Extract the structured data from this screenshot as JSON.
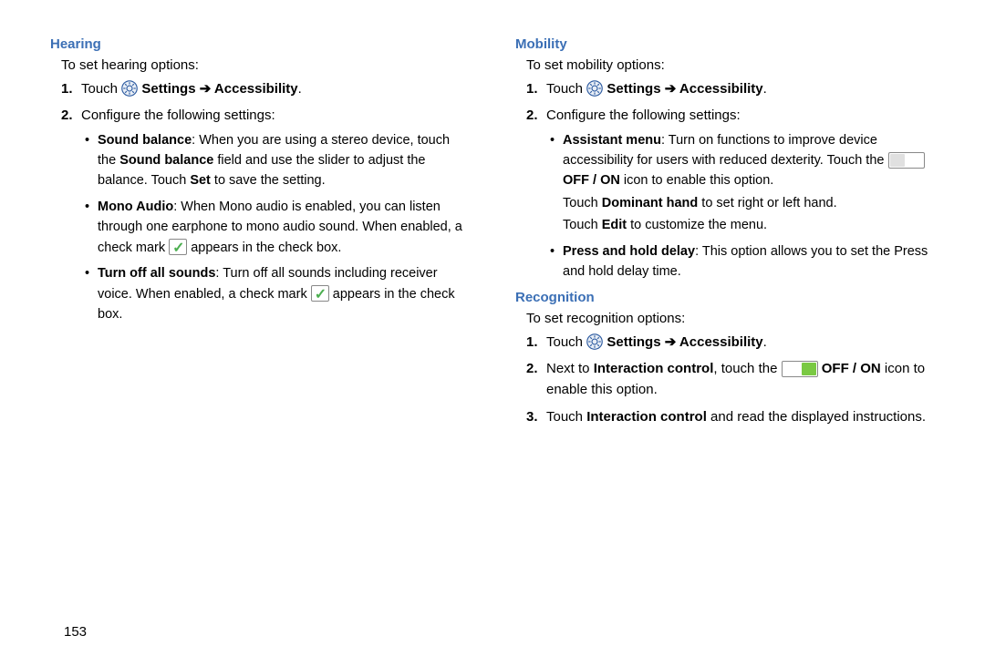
{
  "page_number": "153",
  "left": {
    "header": "Hearing",
    "intro": "To set hearing options:",
    "step1_touch": "Touch ",
    "step1_settings": "Settings",
    "step1_arrow": " ➔ ",
    "step1_accessibility": "Accessibility",
    "step1_period": ".",
    "step2": "Configure the following settings:",
    "bullets": {
      "b1_label": "Sound balance",
      "b1_text_a": ": When you are using a stereo device, touch the ",
      "b1_bold2": "Sound balance",
      "b1_text_b": " field and use the slider to adjust the balance. Touch ",
      "b1_bold3": "Set",
      "b1_text_c": " to save the setting.",
      "b2_label": "Mono Audio",
      "b2_text_a": ": When Mono audio is enabled, you can listen through one earphone to mono audio sound. When enabled, a check mark ",
      "b2_text_b": " appears in the check box.",
      "b3_label": "Turn off all sounds",
      "b3_text_a": ": Turn off all sounds including receiver voice. When enabled, a check mark ",
      "b3_text_b": " appears in the check box."
    }
  },
  "right": {
    "mobility": {
      "header": "Mobility",
      "intro": "To set mobility options:",
      "step1_touch": "Touch ",
      "step1_settings": "Settings",
      "step1_arrow": " ➔ ",
      "step1_accessibility": "Accessibility",
      "step1_period": ".",
      "step2": "Configure the following settings:",
      "b1_label": "Assistant menu",
      "b1_text_a": ": Turn on functions to improve device accessibility for users with reduced dexterity. Touch the ",
      "b1_offon": " OFF / ON",
      "b1_text_b": " icon to enable this option.",
      "b1_sub1_a": "Touch ",
      "b1_sub1_bold": "Dominant hand",
      "b1_sub1_b": " to set right or left hand.",
      "b1_sub2_a": "Touch ",
      "b1_sub2_bold": "Edit",
      "b1_sub2_b": " to customize the menu.",
      "b2_label": "Press and hold delay",
      "b2_text": ": This option allows you to set the Press and hold delay time."
    },
    "recognition": {
      "header": "Recognition",
      "intro": "To set recognition options:",
      "step1_touch": "Touch ",
      "step1_settings": "Settings",
      "step1_arrow": " ➔ ",
      "step1_accessibility": "Accessibility",
      "step1_period": ".",
      "step2_a": "Next to ",
      "step2_bold": "Interaction control",
      "step2_b": ", touch the ",
      "step2_offon": " OFF / ON",
      "step2_c": " icon to enable this option.",
      "step3_a": "Touch ",
      "step3_bold": "Interaction control",
      "step3_b": " and read the displayed instructions."
    }
  }
}
